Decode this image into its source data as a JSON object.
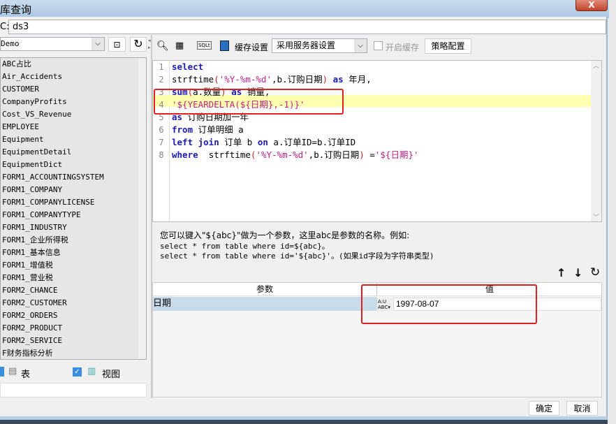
{
  "window": {
    "title": "库查询",
    "close_label": "X"
  },
  "datasource": {
    "label": "C:",
    "value": "ds3"
  },
  "left": {
    "connection": "Demo",
    "tables": [
      "ABC占比",
      "Air_Accidents",
      "CUSTOMER",
      "CompanyProfits",
      "Cost_VS_Revenue",
      "EMPLOYEE",
      "Equipment",
      "EquipmentDetail",
      "EquipmentDict",
      "FORM1_ACCOUNTINGSYSTEM",
      "FORM1_COMPANY",
      "FORM1_COMPANYLICENSE",
      "FORM1_COMPANYTYPE",
      "FORM1_INDUSTRY",
      "FORM1_企业所得税",
      "FORM1_基本信息",
      "FORM1_增值税",
      "FORM1_营业税",
      "FORM2_CHANCE",
      "FORM2_CUSTOMER",
      "FORM2_ORDERS",
      "FORM2_PRODUCT",
      "FORM2_SERVICE",
      "F财务指标分析"
    ],
    "table_checkbox_label": "表",
    "view_checkbox_label": "视图",
    "view_checked": true,
    "table_checked": true
  },
  "toolbar": {
    "cache_label": "缓存设置",
    "cache_select": "采用服务器设置",
    "enable_cache_label": "开启缓存",
    "enable_cache_checked": false,
    "strategy_button": "策略配置"
  },
  "editor": {
    "lines": [
      [
        {
          "t": "select",
          "c": "kw"
        }
      ],
      [
        {
          "t": "strftime",
          "c": "fn"
        },
        {
          "t": "(",
          "c": "red"
        },
        {
          "t": "'%Y-%m-%d'",
          "c": "str"
        },
        {
          "t": ",b.订购日期",
          "c": "fn"
        },
        {
          "t": ")",
          "c": "red"
        },
        {
          "t": " ",
          "c": "fn"
        },
        {
          "t": "as",
          "c": "kw"
        },
        {
          "t": " 年月,",
          "c": "fn"
        }
      ],
      [
        {
          "t": "sum",
          "c": "kw"
        },
        {
          "t": "(",
          "c": "red"
        },
        {
          "t": "a.数量",
          "c": "fn"
        },
        {
          "t": ")",
          "c": "red"
        },
        {
          "t": " ",
          "c": "fn"
        },
        {
          "t": "as",
          "c": "kw"
        },
        {
          "t": " 销量,",
          "c": "fn"
        }
      ],
      [
        {
          "t": "'${YEARDELTA(${日期},-1)}'",
          "c": "str"
        }
      ],
      [
        {
          "t": "as",
          "c": "kw"
        },
        {
          "t": " 订购日期加一年",
          "c": "fn"
        }
      ],
      [
        {
          "t": "from",
          "c": "kw"
        },
        {
          "t": " 订单明细 a",
          "c": "fn"
        }
      ],
      [
        {
          "t": "left join",
          "c": "kw"
        },
        {
          "t": " 订单 b ",
          "c": "fn"
        },
        {
          "t": "on",
          "c": "kw"
        },
        {
          "t": " a.订单ID=b.订单ID",
          "c": "fn"
        }
      ],
      [
        {
          "t": "where",
          "c": "kw"
        },
        {
          "t": "  strftime",
          "c": "fn"
        },
        {
          "t": "(",
          "c": "red"
        },
        {
          "t": "'%Y-%m-%d'",
          "c": "str"
        },
        {
          "t": ",b.订购日期",
          "c": "fn"
        },
        {
          "t": ")",
          "c": "red"
        },
        {
          "t": " =",
          "c": "fn"
        },
        {
          "t": "'${日期}'",
          "c": "str"
        }
      ]
    ],
    "highlighted_line": 4
  },
  "help": {
    "line1": "您可以键入\"${abc}\"做为一个参数，这里abc是参数的名称。例如:",
    "line2": "select * from table where id=${abc}。",
    "line3": "select * from table where id='${abc}'。(如果id字段为字符串类型)"
  },
  "params": {
    "col_param": "参数",
    "col_value": "值",
    "rows": [
      {
        "name": "日期",
        "value": "1997-08-07",
        "type_icon": "ABC"
      }
    ]
  },
  "footer": {
    "ok": "确定",
    "cancel": "取消"
  }
}
